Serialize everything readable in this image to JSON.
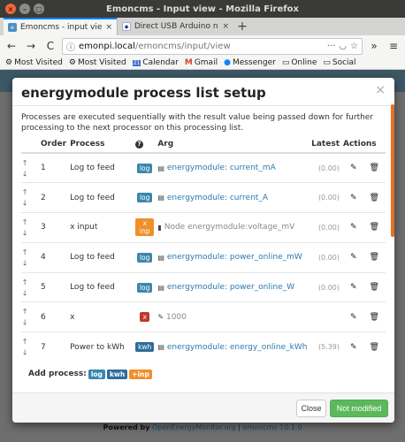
{
  "window": {
    "title": "Emoncms - Input view - Mozilla Firefox",
    "close_glyph": "×",
    "min_glyph": "–",
    "max_glyph": "□"
  },
  "tabs": [
    {
      "label": "Emoncms - input view",
      "close": "×",
      "active": true
    },
    {
      "label": "Direct USB Arduino not s",
      "close": "×",
      "active": false
    }
  ],
  "newtab_glyph": "+",
  "nav": {
    "back": "←",
    "forward": "→",
    "reload": "C",
    "url_host": "emonpi.local",
    "url_path": "/emoncms/input/view",
    "more": "···",
    "menu": "≡",
    "sidebar": "»"
  },
  "bookmarks": [
    {
      "icon": "gear-icon",
      "glyph": "⚙",
      "label": "Most Visited"
    },
    {
      "icon": "gear-icon",
      "glyph": "⚙",
      "label": "Most Visited"
    },
    {
      "icon": "calendar-icon",
      "glyph": "21",
      "label": "Calendar"
    },
    {
      "icon": "gmail-icon",
      "glyph": "M",
      "label": "Gmail"
    },
    {
      "icon": "messenger-icon",
      "glyph": "●",
      "label": "Messenger"
    },
    {
      "icon": "folder-icon",
      "glyph": "▭",
      "label": "Online"
    },
    {
      "icon": "folder-icon",
      "glyph": "▭",
      "label": "Social"
    }
  ],
  "modal": {
    "title": "energymodule process list setup",
    "close_glyph": "×",
    "intro": "Processes are executed sequentially with the result value being passed down for further processing to the next processor on this processing list.",
    "headers": {
      "order": "Order",
      "process": "Process",
      "help": "?",
      "arg": "Arg",
      "latest": "Latest",
      "actions": "Actions"
    },
    "rows": [
      {
        "order": "1",
        "process": "Log to feed",
        "badge": "log",
        "badge_kind": "log",
        "arg_icon": "feed-icon",
        "arg_glyph": "▤",
        "arg": "energymodule: current_mA",
        "arg_kind": "link",
        "latest": "(0.00)"
      },
      {
        "order": "2",
        "process": "Log to feed",
        "badge": "log",
        "badge_kind": "log",
        "arg_icon": "feed-icon",
        "arg_glyph": "▤",
        "arg": "energymodule: current_A",
        "arg_kind": "link",
        "latest": "(0.00)"
      },
      {
        "order": "3",
        "process": "x input",
        "badge": "x inp",
        "badge_kind": "inp",
        "arg_icon": "signal-icon",
        "arg_glyph": "▮",
        "arg": "Node energymodule:voltage_mV",
        "arg_kind": "grey",
        "latest": "(0.00)"
      },
      {
        "order": "4",
        "process": "Log to feed",
        "badge": "log",
        "badge_kind": "log",
        "arg_icon": "feed-icon",
        "arg_glyph": "▤",
        "arg": "energymodule: power_online_mW",
        "arg_kind": "link",
        "latest": "(0.00)"
      },
      {
        "order": "5",
        "process": "Log to feed",
        "badge": "log",
        "badge_kind": "log",
        "arg_icon": "feed-icon",
        "arg_glyph": "▤",
        "arg": "energymodule: power_online_W",
        "arg_kind": "link",
        "latest": "(0.00)"
      },
      {
        "order": "6",
        "process": "x",
        "badge": "x",
        "badge_kind": "x",
        "arg_icon": "edit-value-icon",
        "arg_glyph": "✎",
        "arg": "1000",
        "arg_kind": "grey",
        "latest": ""
      },
      {
        "order": "7",
        "process": "Power to kWh",
        "badge": "kwh",
        "badge_kind": "kwh",
        "arg_icon": "feed-icon",
        "arg_glyph": "▤",
        "arg": "energymodule: energy_online_kWh",
        "arg_kind": "link",
        "latest": "(5.39)"
      }
    ],
    "add_process": {
      "label": "Add process:",
      "badges": [
        "log",
        "kwh",
        "+inp"
      ]
    },
    "buttons": {
      "close": "Close",
      "save": "Not modified"
    }
  },
  "footer": {
    "prefix": "Powered by",
    "link": "OpenEnergyMonitor.org",
    "sep": "|",
    "version": "emoncms 10.1.0"
  }
}
